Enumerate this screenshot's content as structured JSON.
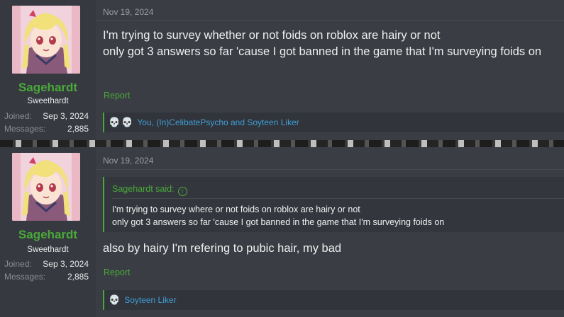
{
  "posts": [
    {
      "user": {
        "name": "Sagehardt",
        "title": "Sweethardt",
        "joined_label": "Joined:",
        "joined_value": "Sep 3, 2024",
        "messages_label": "Messages:",
        "messages_value": "2,885"
      },
      "date": "Nov 19, 2024",
      "body_lines": [
        "I'm trying to survey whether or not foids on roblox are hairy or not",
        "only got 3 answers so far 'cause I got banned in the game that I'm surveying foids on"
      ],
      "report_label": "Report",
      "reactions": {
        "icons": [
          "skull-icon",
          "skull-icon"
        ],
        "text": "You, (In)CelibatePsycho and Soyteen Liker"
      }
    },
    {
      "user": {
        "name": "Sagehardt",
        "title": "Sweethardt",
        "joined_label": "Joined:",
        "joined_value": "Sep 3, 2024",
        "messages_label": "Messages:",
        "messages_value": "2,885"
      },
      "date": "Nov 19, 2024",
      "quote": {
        "author_said": "Sagehardt said:",
        "lines": [
          "I'm trying to survey where or not foids on roblox are hairy or not",
          "only got 3 answers so far 'cause I got banned in the game that I'm surveying foids on"
        ]
      },
      "body_lines": [
        "also by hairy I'm refering to pubic hair, my bad"
      ],
      "report_label": "Report",
      "reactions": {
        "icons": [
          "skull-icon"
        ],
        "text": "Soyteen Liker"
      }
    }
  ],
  "colors": {
    "accent_green": "#4aa83a",
    "link_blue": "#3f9fd8",
    "message_bg": "#3a3e44",
    "user_bg": "#363a40"
  }
}
